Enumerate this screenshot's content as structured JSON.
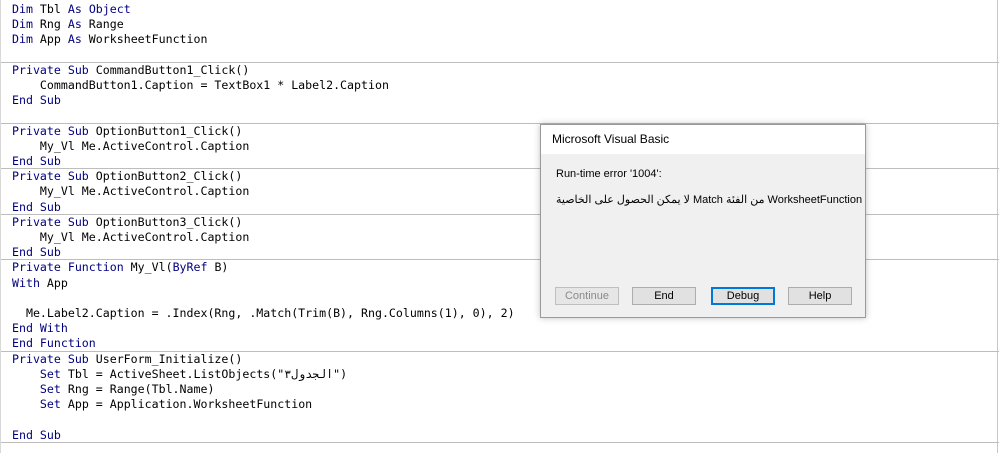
{
  "code_lines": [
    {
      "parts": [
        {
          "t": "Dim",
          "k": true
        },
        {
          "t": " Tbl "
        },
        {
          "t": "As",
          "k": true
        },
        {
          "t": " "
        },
        {
          "t": "Object",
          "k": true
        }
      ]
    },
    {
      "parts": [
        {
          "t": "Dim",
          "k": true
        },
        {
          "t": " Rng "
        },
        {
          "t": "As",
          "k": true
        },
        {
          "t": " Range"
        }
      ]
    },
    {
      "parts": [
        {
          "t": "Dim",
          "k": true
        },
        {
          "t": " App "
        },
        {
          "t": "As",
          "k": true
        },
        {
          "t": " WorksheetFunction"
        }
      ]
    },
    {
      "parts": []
    },
    {
      "parts": [
        {
          "t": "Private Sub",
          "k": true
        },
        {
          "t": " CommandButton1_Click()"
        }
      ]
    },
    {
      "parts": [
        {
          "t": "    CommandButton1.Caption = TextBox1 * Label2.Caption"
        }
      ]
    },
    {
      "parts": [
        {
          "t": "End Sub",
          "k": true
        }
      ]
    },
    {
      "parts": []
    },
    {
      "parts": [
        {
          "t": "Private Sub",
          "k": true
        },
        {
          "t": " OptionButton1_Click()"
        }
      ]
    },
    {
      "parts": [
        {
          "t": "    My_Vl Me.ActiveControl.Caption"
        }
      ]
    },
    {
      "parts": [
        {
          "t": "End Sub",
          "k": true
        }
      ]
    },
    {
      "parts": [
        {
          "t": "Private Sub",
          "k": true
        },
        {
          "t": " OptionButton2_Click()"
        }
      ]
    },
    {
      "parts": [
        {
          "t": "    My_Vl Me.ActiveControl.Caption"
        }
      ]
    },
    {
      "parts": [
        {
          "t": "End Sub",
          "k": true
        }
      ]
    },
    {
      "parts": [
        {
          "t": "Private Sub",
          "k": true
        },
        {
          "t": " OptionButton3_Click()"
        }
      ]
    },
    {
      "parts": [
        {
          "t": "    My_Vl Me.ActiveControl.Caption"
        }
      ]
    },
    {
      "parts": [
        {
          "t": "End Sub",
          "k": true
        }
      ]
    },
    {
      "parts": [
        {
          "t": "Private Function",
          "k": true
        },
        {
          "t": " My_Vl("
        },
        {
          "t": "ByRef",
          "k": true
        },
        {
          "t": " B)"
        }
      ]
    },
    {
      "parts": [
        {
          "t": "With",
          "k": true
        },
        {
          "t": " App"
        }
      ]
    },
    {
      "parts": []
    },
    {
      "parts": [
        {
          "t": "  Me.Label2.Caption = .Index(Rng, .Match(Trim(B), Rng.Columns(1), 0), 2)"
        }
      ]
    },
    {
      "parts": [
        {
          "t": "End With",
          "k": true
        }
      ]
    },
    {
      "parts": [
        {
          "t": "End Function",
          "k": true
        }
      ]
    },
    {
      "parts": [
        {
          "t": "Private Sub",
          "k": true
        },
        {
          "t": " UserForm_Initialize()"
        }
      ]
    },
    {
      "parts": [
        {
          "t": "    "
        },
        {
          "t": "Set",
          "k": true
        },
        {
          "t": " Tbl = ActiveSheet.ListObjects(\"الجدول٣\")"
        }
      ]
    },
    {
      "parts": [
        {
          "t": "    "
        },
        {
          "t": "Set",
          "k": true
        },
        {
          "t": " Rng = Range(Tbl.Name)"
        }
      ]
    },
    {
      "parts": [
        {
          "t": "    "
        },
        {
          "t": "Set",
          "k": true
        },
        {
          "t": " App = Application.WorksheetFunction"
        }
      ]
    },
    {
      "parts": []
    },
    {
      "parts": [
        {
          "t": "End Sub",
          "k": true
        }
      ]
    }
  ],
  "dialog": {
    "title": "Microsoft Visual Basic",
    "error_line": "Run-time error '1004':",
    "message": "WorksheetFunction من الفئة Match لا يمكن الحصول على الخاصية",
    "buttons": {
      "continue": "Continue",
      "end": "End",
      "debug": "Debug",
      "help": "Help"
    }
  }
}
